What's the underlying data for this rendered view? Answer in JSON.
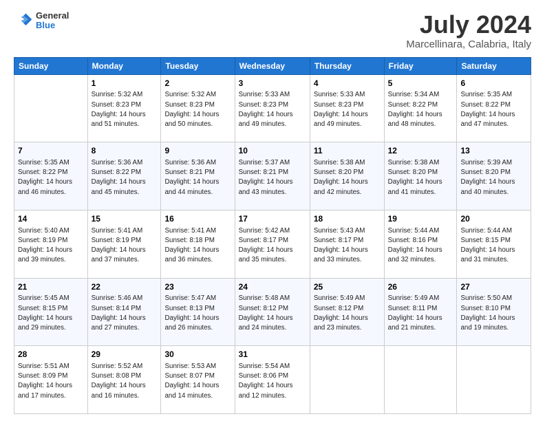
{
  "logo": {
    "general": "General",
    "blue": "Blue"
  },
  "header": {
    "month": "July 2024",
    "location": "Marcellinara, Calabria, Italy"
  },
  "weekdays": [
    "Sunday",
    "Monday",
    "Tuesday",
    "Wednesday",
    "Thursday",
    "Friday",
    "Saturday"
  ],
  "weeks": [
    [
      {
        "day": "",
        "info": ""
      },
      {
        "day": "1",
        "info": "Sunrise: 5:32 AM\nSunset: 8:23 PM\nDaylight: 14 hours\nand 51 minutes."
      },
      {
        "day": "2",
        "info": "Sunrise: 5:32 AM\nSunset: 8:23 PM\nDaylight: 14 hours\nand 50 minutes."
      },
      {
        "day": "3",
        "info": "Sunrise: 5:33 AM\nSunset: 8:23 PM\nDaylight: 14 hours\nand 49 minutes."
      },
      {
        "day": "4",
        "info": "Sunrise: 5:33 AM\nSunset: 8:23 PM\nDaylight: 14 hours\nand 49 minutes."
      },
      {
        "day": "5",
        "info": "Sunrise: 5:34 AM\nSunset: 8:22 PM\nDaylight: 14 hours\nand 48 minutes."
      },
      {
        "day": "6",
        "info": "Sunrise: 5:35 AM\nSunset: 8:22 PM\nDaylight: 14 hours\nand 47 minutes."
      }
    ],
    [
      {
        "day": "7",
        "info": "Sunrise: 5:35 AM\nSunset: 8:22 PM\nDaylight: 14 hours\nand 46 minutes."
      },
      {
        "day": "8",
        "info": "Sunrise: 5:36 AM\nSunset: 8:22 PM\nDaylight: 14 hours\nand 45 minutes."
      },
      {
        "day": "9",
        "info": "Sunrise: 5:36 AM\nSunset: 8:21 PM\nDaylight: 14 hours\nand 44 minutes."
      },
      {
        "day": "10",
        "info": "Sunrise: 5:37 AM\nSunset: 8:21 PM\nDaylight: 14 hours\nand 43 minutes."
      },
      {
        "day": "11",
        "info": "Sunrise: 5:38 AM\nSunset: 8:20 PM\nDaylight: 14 hours\nand 42 minutes."
      },
      {
        "day": "12",
        "info": "Sunrise: 5:38 AM\nSunset: 8:20 PM\nDaylight: 14 hours\nand 41 minutes."
      },
      {
        "day": "13",
        "info": "Sunrise: 5:39 AM\nSunset: 8:20 PM\nDaylight: 14 hours\nand 40 minutes."
      }
    ],
    [
      {
        "day": "14",
        "info": "Sunrise: 5:40 AM\nSunset: 8:19 PM\nDaylight: 14 hours\nand 39 minutes."
      },
      {
        "day": "15",
        "info": "Sunrise: 5:41 AM\nSunset: 8:19 PM\nDaylight: 14 hours\nand 37 minutes."
      },
      {
        "day": "16",
        "info": "Sunrise: 5:41 AM\nSunset: 8:18 PM\nDaylight: 14 hours\nand 36 minutes."
      },
      {
        "day": "17",
        "info": "Sunrise: 5:42 AM\nSunset: 8:17 PM\nDaylight: 14 hours\nand 35 minutes."
      },
      {
        "day": "18",
        "info": "Sunrise: 5:43 AM\nSunset: 8:17 PM\nDaylight: 14 hours\nand 33 minutes."
      },
      {
        "day": "19",
        "info": "Sunrise: 5:44 AM\nSunset: 8:16 PM\nDaylight: 14 hours\nand 32 minutes."
      },
      {
        "day": "20",
        "info": "Sunrise: 5:44 AM\nSunset: 8:15 PM\nDaylight: 14 hours\nand 31 minutes."
      }
    ],
    [
      {
        "day": "21",
        "info": "Sunrise: 5:45 AM\nSunset: 8:15 PM\nDaylight: 14 hours\nand 29 minutes."
      },
      {
        "day": "22",
        "info": "Sunrise: 5:46 AM\nSunset: 8:14 PM\nDaylight: 14 hours\nand 27 minutes."
      },
      {
        "day": "23",
        "info": "Sunrise: 5:47 AM\nSunset: 8:13 PM\nDaylight: 14 hours\nand 26 minutes."
      },
      {
        "day": "24",
        "info": "Sunrise: 5:48 AM\nSunset: 8:12 PM\nDaylight: 14 hours\nand 24 minutes."
      },
      {
        "day": "25",
        "info": "Sunrise: 5:49 AM\nSunset: 8:12 PM\nDaylight: 14 hours\nand 23 minutes."
      },
      {
        "day": "26",
        "info": "Sunrise: 5:49 AM\nSunset: 8:11 PM\nDaylight: 14 hours\nand 21 minutes."
      },
      {
        "day": "27",
        "info": "Sunrise: 5:50 AM\nSunset: 8:10 PM\nDaylight: 14 hours\nand 19 minutes."
      }
    ],
    [
      {
        "day": "28",
        "info": "Sunrise: 5:51 AM\nSunset: 8:09 PM\nDaylight: 14 hours\nand 17 minutes."
      },
      {
        "day": "29",
        "info": "Sunrise: 5:52 AM\nSunset: 8:08 PM\nDaylight: 14 hours\nand 16 minutes."
      },
      {
        "day": "30",
        "info": "Sunrise: 5:53 AM\nSunset: 8:07 PM\nDaylight: 14 hours\nand 14 minutes."
      },
      {
        "day": "31",
        "info": "Sunrise: 5:54 AM\nSunset: 8:06 PM\nDaylight: 14 hours\nand 12 minutes."
      },
      {
        "day": "",
        "info": ""
      },
      {
        "day": "",
        "info": ""
      },
      {
        "day": "",
        "info": ""
      }
    ]
  ]
}
